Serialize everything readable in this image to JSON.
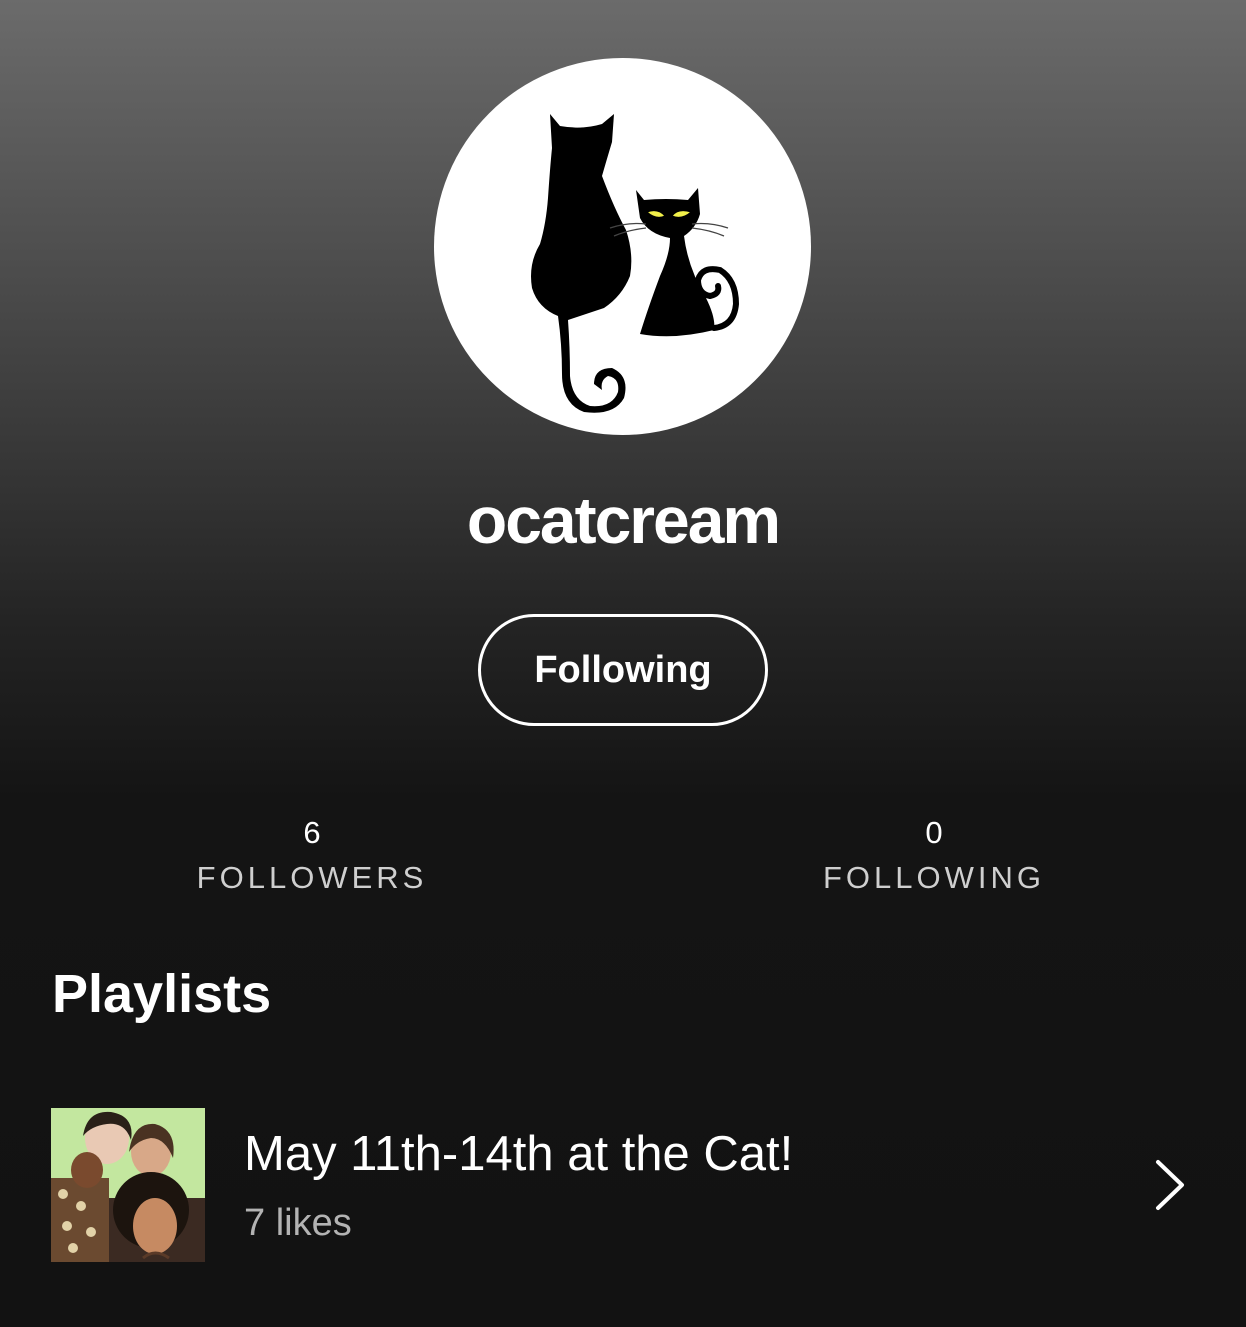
{
  "profile": {
    "username": "ocatcream",
    "follow_button_label": "Following"
  },
  "stats": {
    "followers_count": "6",
    "followers_label": "FOLLOWERS",
    "following_count": "0",
    "following_label": "FOLLOWING"
  },
  "playlists": {
    "section_title": "Playlists",
    "items": [
      {
        "title": "May 11th-14th at the Cat!",
        "likes": "7 likes"
      }
    ]
  },
  "colors": {
    "background": "#121212",
    "text": "#ffffff",
    "secondary_text": "#b3b3b3",
    "stat_label": "#cfcfcf",
    "cat_eye": "#f2f04a"
  },
  "icons": {
    "avatar": "two-black-cats-logo",
    "row_action": "chevron-right-icon"
  }
}
